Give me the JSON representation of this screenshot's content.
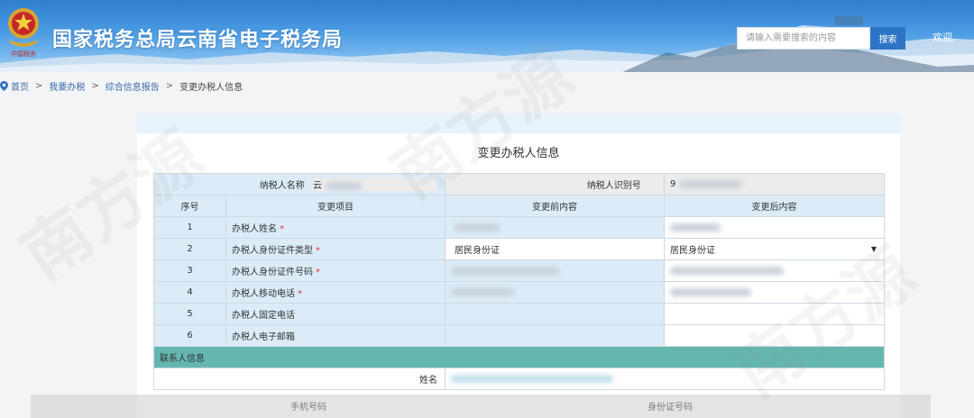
{
  "header": {
    "title": "国家税务总局云南省电子税务局",
    "search_placeholder": "请输入需要搜索的内容",
    "search_button": "搜索",
    "welcome": "欢迎,",
    "emblem_icon": "tax-emblem-icon"
  },
  "breadcrumb": {
    "items": [
      "首页",
      "我要办税",
      "综合信息报告",
      "变更办税人信息"
    ],
    "separator": ">"
  },
  "form": {
    "title": "变更办税人信息",
    "taxpayer_name_label": "纳税人名称",
    "taxpayer_name_value": "云",
    "taxpayer_id_label": "纳税人识别号",
    "taxpayer_id_value": "9",
    "columns": [
      "序号",
      "变更项目",
      "变更前内容",
      "变更后内容"
    ],
    "rows": [
      {
        "seq": "1",
        "item": "办税人姓名",
        "required": "*",
        "before": "",
        "after": ""
      },
      {
        "seq": "2",
        "item": "办税人身份证件类型",
        "required": "*",
        "before": "居民身份证",
        "after": "居民身份证"
      },
      {
        "seq": "3",
        "item": "办税人身份证件号码",
        "required": "*",
        "before": "",
        "after": ""
      },
      {
        "seq": "4",
        "item": "办税人移动电话",
        "required": "*",
        "before": "",
        "after": ""
      },
      {
        "seq": "5",
        "item": "办税人固定电话",
        "required": "",
        "before": "",
        "after": ""
      },
      {
        "seq": "6",
        "item": "办税人电子邮箱",
        "required": "",
        "before": "",
        "after": ""
      }
    ],
    "contact_section": "联系人信息",
    "contact_name_label": "姓名",
    "mobile_label": "手机号码",
    "id_number_label": "身份证号码"
  },
  "colors": {
    "accent": "#2e74c4",
    "header_blue": "#3a8ddb",
    "table_header": "#dbecf8",
    "contact_bar": "#64b7af",
    "required": "#e03333"
  },
  "watermark": "南方源"
}
